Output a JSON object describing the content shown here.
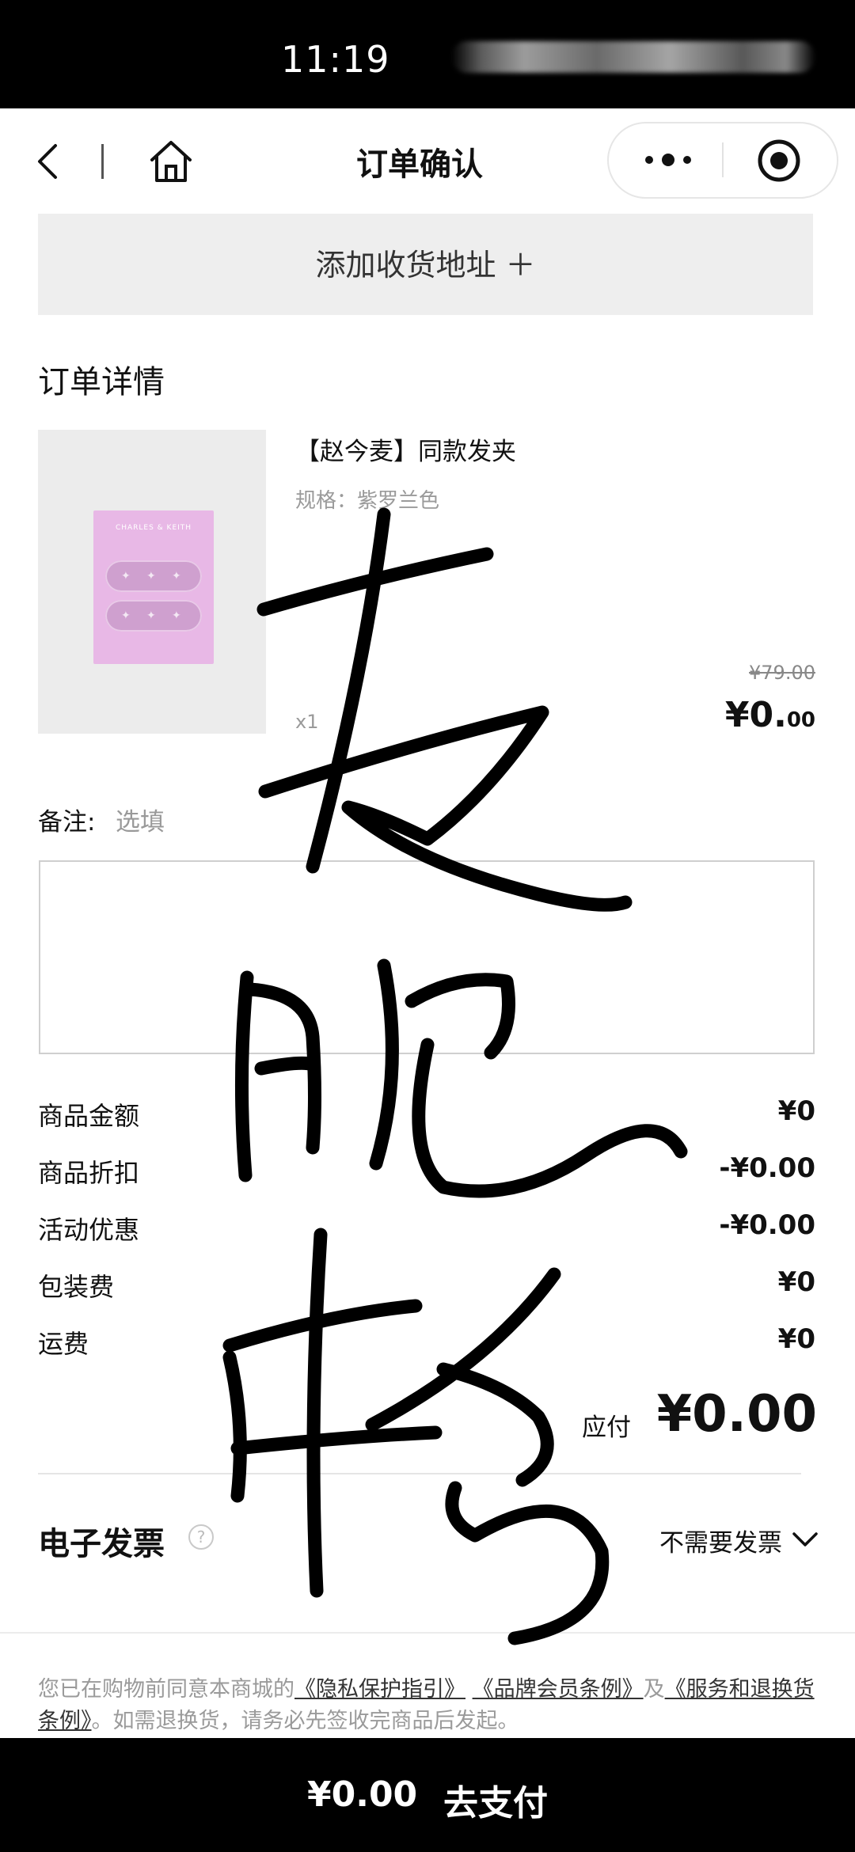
{
  "status_bar": {
    "time": "11:19"
  },
  "nav": {
    "title": "订单确认",
    "icons": [
      "back-icon",
      "home-icon",
      "more-icon",
      "target-icon"
    ]
  },
  "address": {
    "add_label": "添加收货地址 ＋"
  },
  "order": {
    "section_title": "订单详情",
    "product": {
      "brand_on_image": "CHARLES & KEITH",
      "name": "【赵今麦】同款发夹",
      "spec": "规格：紫罗兰色",
      "quantity": "x1",
      "original_price": "¥79.00",
      "price_main": "¥0.",
      "price_cents": "00"
    }
  },
  "remark": {
    "label": "备注:",
    "placeholder": "选填",
    "value": ""
  },
  "summary": [
    {
      "label": "商品金额",
      "value": "¥0"
    },
    {
      "label": "商品折扣",
      "value": "-¥0.00"
    },
    {
      "label": "活动优惠",
      "value": "-¥0.00"
    },
    {
      "label": "包装费",
      "value": "¥0"
    },
    {
      "label": "运费",
      "value": "¥0"
    }
  ],
  "payable": {
    "label": "应付",
    "value": "¥0.00"
  },
  "invoice": {
    "label": "电子发票",
    "help": "?",
    "value": "不需要发票"
  },
  "agreement": {
    "prefix": "您已在购物前同意本商城的",
    "privacy": "《隐私保护指引》",
    "member": "《品牌会员条例》",
    "and": "及",
    "service": "《服务和退换货条例》",
    "suffix": "。如需退换货，请务必先签收完商品后发起。"
  },
  "paybar": {
    "amount": "¥0.00",
    "button": "去支付"
  },
  "colors": {
    "background": "#ffffff",
    "bars": "#000000",
    "address_bg": "#eeeeee",
    "product_card": "#e8b8e6"
  }
}
